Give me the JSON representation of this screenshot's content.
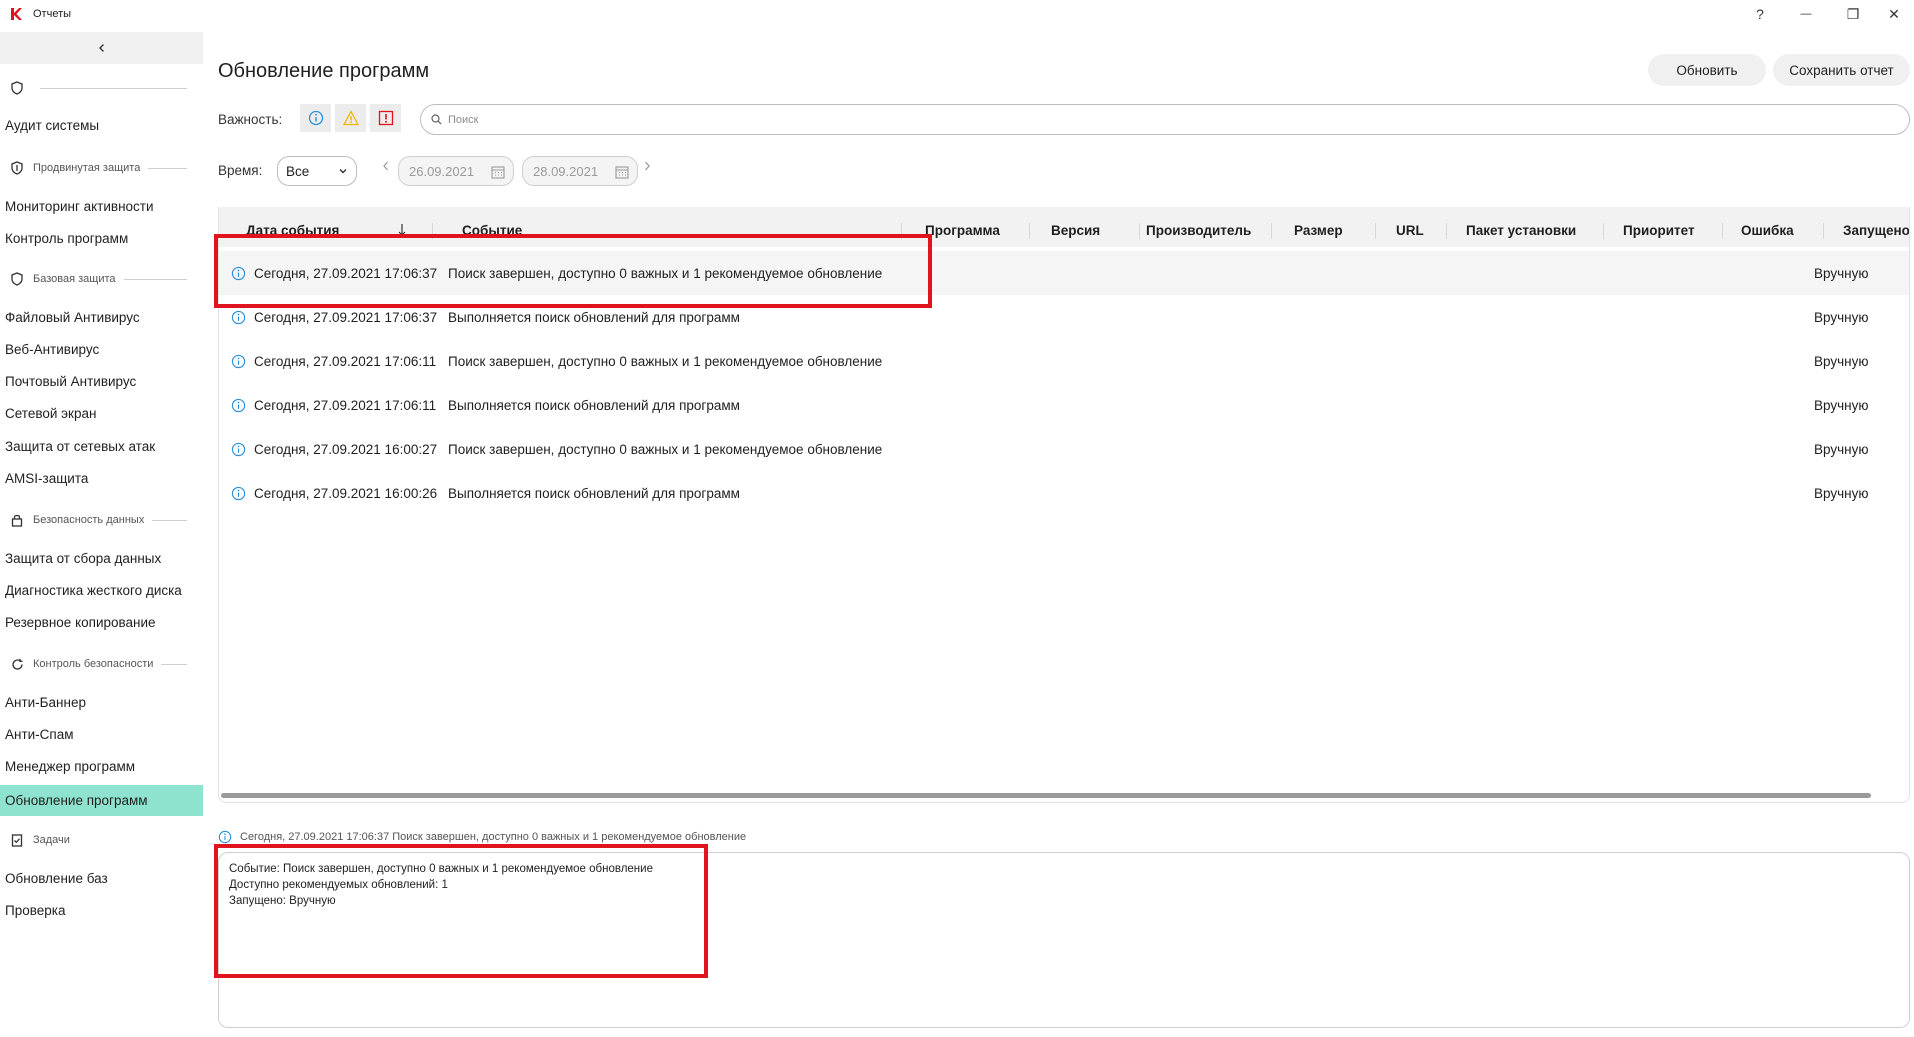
{
  "app": {
    "title": "Отчеты"
  },
  "window_controls": {
    "help": "?",
    "minimize": "—",
    "restore": "❐",
    "close": "✕"
  },
  "sidebar": {
    "collapse_icon": "chevron-left-icon",
    "top_group_icon": "shield-icon",
    "audit": "Аудит системы",
    "groups": {
      "advanced": "Продвинутая защита",
      "basic": "Базовая защита",
      "data": "Безопасность данных",
      "control": "Контроль безопасности",
      "tasks": "Задачи"
    },
    "items": {
      "activity": "Мониторинг активности",
      "app_control": "Контроль программ",
      "file_av": "Файловый Антивирус",
      "web_av": "Веб-Антивирус",
      "mail_av": "Почтовый Антивирус",
      "firewall": "Сетевой экран",
      "net_attack": "Защита от сетевых атак",
      "amsi": "AMSI-защита",
      "data_collection": "Защита от сбора данных",
      "disk_diag": "Диагностика жесткого диска",
      "backup": "Резервное копирование",
      "anti_banner": "Анти-Баннер",
      "anti_spam": "Анти-Спам",
      "app_manager": "Менеджер программ",
      "app_update": "Обновление программ",
      "db_update": "Обновление баз",
      "scan": "Проверка"
    },
    "active_item": "app_update"
  },
  "main": {
    "title": "Обновление программ",
    "refresh_button": "Обновить",
    "save_button": "Сохранить отчет",
    "severity_label": "Важность:",
    "search_placeholder": "Поиск",
    "time_label": "Время:",
    "time_value": "Все",
    "date_from": "26.09.2021",
    "date_to": "28.09.2021"
  },
  "table": {
    "columns": [
      "Дата события",
      "Событие",
      "Программа",
      "Версия",
      "Производитель",
      "Размер",
      "URL",
      "Пакет установки",
      "Приоритет",
      "Ошибка",
      "Запущено"
    ],
    "rows": [
      {
        "date": "Сегодня, 27.09.2021 17:06:37",
        "event": "Поиск завершен, доступно 0 важных и 1 рекомендуемое обновление",
        "launched": "Вручную"
      },
      {
        "date": "Сегодня, 27.09.2021 17:06:37",
        "event": "Выполняется поиск обновлений для программ",
        "launched": "Вручную"
      },
      {
        "date": "Сегодня, 27.09.2021 17:06:11",
        "event": "Поиск завершен, доступно 0 важных и 1 рекомендуемое обновление",
        "launched": "Вручную"
      },
      {
        "date": "Сегодня, 27.09.2021 17:06:11",
        "event": "Выполняется поиск обновлений для программ",
        "launched": "Вручную"
      },
      {
        "date": "Сегодня, 27.09.2021 16:00:27",
        "event": "Поиск завершен, доступно 0 важных и 1 рекомендуемое обновление",
        "launched": "Вручную"
      },
      {
        "date": "Сегодня, 27.09.2021 16:00:26",
        "event": "Выполняется поиск обновлений для программ",
        "launched": "Вручную"
      }
    ]
  },
  "details": {
    "header": "Сегодня, 27.09.2021 17:06:37 Поиск завершен, доступно 0 важных и 1 рекомендуемое обновление",
    "lines": [
      "Событие: Поиск завершен, доступно 0 важных и 1 рекомендуемое обновление",
      "Доступно рекомендуемых обновлений: 1",
      "Запущено: Вручную"
    ]
  },
  "colors": {
    "active_bg": "#8ee3cf",
    "info_blue": "#2a8fd8",
    "warning": "#f2b400",
    "critical": "#e0141e",
    "highlight": "#e0141e"
  }
}
